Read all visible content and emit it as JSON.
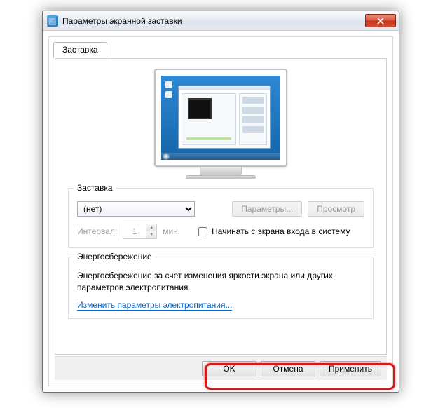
{
  "window": {
    "title": "Параметры экранной заставки"
  },
  "tabs": {
    "screensaver": "Заставка"
  },
  "group_saver": {
    "title": "Заставка",
    "selected": "(нет)",
    "settings_btn": "Параметры...",
    "preview_btn": "Просмотр",
    "interval_label": "Интервал:",
    "interval_value": "1",
    "interval_unit": "мин.",
    "resume_checkbox": "Начинать с экрана входа в систему"
  },
  "group_power": {
    "title": "Энергосбережение",
    "desc": "Энергосбережение за счет изменения яркости экрана или других параметров электропитания.",
    "link": "Изменить параметры электропитания..."
  },
  "buttons": {
    "ok": "OK",
    "cancel": "Отмена",
    "apply": "Применить"
  }
}
